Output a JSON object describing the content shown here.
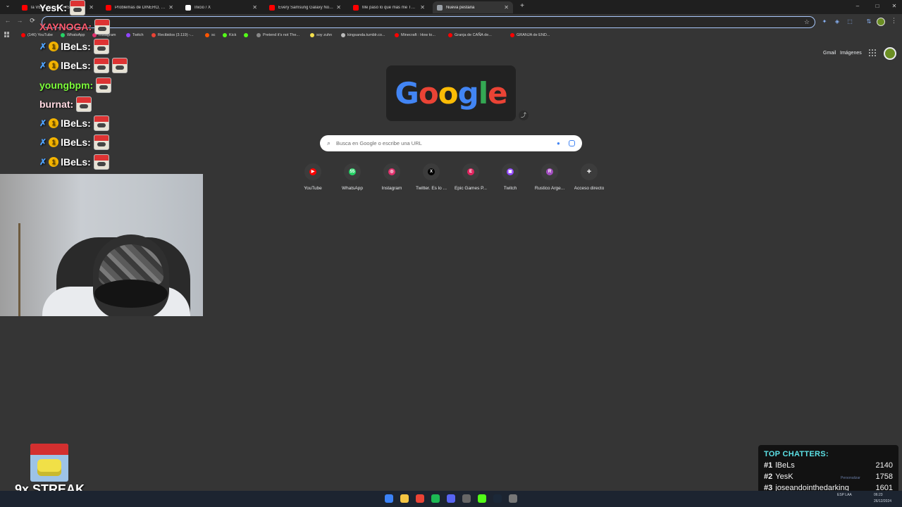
{
  "browser": {
    "tabs": [
      {
        "label": "la VERDADERA HISTO...",
        "favicon_color": "#ff0000",
        "active": false
      },
      {
        "label": "Problemas de DINERO, Nuestr",
        "favicon_color": "#ff0000",
        "active": false
      },
      {
        "label": "Inicio / X",
        "favicon_color": "#ffffff",
        "active": false
      },
      {
        "label": "Every Samsung Galaxy Notificat",
        "favicon_color": "#ff0000",
        "active": false
      },
      {
        "label": "Me pasó lo que más me TEMÍA",
        "favicon_color": "#ff0000",
        "active": false
      },
      {
        "label": "Nueva pestaña",
        "favicon_color": "#9aa0a6",
        "active": true
      }
    ],
    "new_tab_glyph": "+",
    "window_controls": {
      "minimize": "–",
      "maximize": "□",
      "close": "✕"
    },
    "toolbar": {
      "back": "←",
      "forward": "→",
      "reload": "⟳",
      "star": "☆"
    },
    "extensions": [
      "✦",
      "◈",
      "⬚",
      "⇅"
    ],
    "bookmarks": [
      {
        "label": "(146) YouTube",
        "color": "#ff0000"
      },
      {
        "label": "WhatsApp",
        "color": "#25d366"
      },
      {
        "label": "Instagram",
        "color": "#e1306c"
      },
      {
        "label": "Twitch",
        "color": "#9146ff"
      },
      {
        "label": "Recibidos (3.119) -...",
        "color": "#ea4335"
      },
      {
        "label": "sc",
        "color": "#ff5500"
      },
      {
        "label": "Kick",
        "color": "#53fc18"
      },
      {
        "label": "",
        "color": "#53fc18"
      },
      {
        "label": "Pretend it's not The...",
        "color": "#888888"
      },
      {
        "label": "soy zuhn",
        "color": "#f4e04d"
      },
      {
        "label": "kingsanda.tumblr.co...",
        "color": "#bbbbbb"
      },
      {
        "label": "Minecraft : How to...",
        "color": "#ff0000"
      },
      {
        "label": "Granja de CAÑA de...",
        "color": "#ff0000"
      },
      {
        "label": "GRANJA de END...",
        "color": "#ff0000"
      }
    ]
  },
  "ntp": {
    "gmail": "Gmail",
    "images": "Imágenes",
    "doodle_letters": [
      {
        "ch": "G",
        "color": "#4285f4"
      },
      {
        "ch": "o",
        "color": "#ea4335"
      },
      {
        "ch": "o",
        "color": "#fbbc05"
      },
      {
        "ch": "g",
        "color": "#4285f4"
      },
      {
        "ch": "l",
        "color": "#34a853"
      },
      {
        "ch": "e",
        "color": "#ea4335"
      }
    ],
    "share_glyph": "⤴",
    "search_placeholder": "Busca en Google o escribe una URL",
    "search_glyph": "⌕",
    "mic_glyph": "🎙",
    "shortcuts": [
      {
        "label": "YouTube",
        "color": "#ff0000",
        "glyph": "▶"
      },
      {
        "label": "WhatsApp",
        "color": "#25d366",
        "glyph": "55"
      },
      {
        "label": "Instagram",
        "color": "#e1306c",
        "glyph": "◎"
      },
      {
        "label": "Twitter. Es lo ...",
        "color": "#000000",
        "glyph": "X"
      },
      {
        "label": "Epic Games P...",
        "color": "#e0245e",
        "glyph": "E"
      },
      {
        "label": "Twitch",
        "color": "#9146ff",
        "glyph": "▣"
      },
      {
        "label": "Rustico Arge...",
        "color": "#a24dbf",
        "glyph": "R"
      },
      {
        "label": "Acceso directo",
        "color": "#3c3c3c",
        "glyph": "+"
      }
    ]
  },
  "chat": [
    {
      "user": "YesK:",
      "color": "#ffffff",
      "badges": false,
      "emotes": 1
    },
    {
      "user": "XAYNOGA:",
      "color": "#ff5a6e",
      "badges": false,
      "emotes": 1
    },
    {
      "user": "lBeLs:",
      "color": "#ffffff",
      "badges": true,
      "emotes": 1
    },
    {
      "user": "lBeLs:",
      "color": "#ffffff",
      "badges": true,
      "emotes": 2
    },
    {
      "user": "youngbpm:",
      "color": "#7cfc3a",
      "badges": false,
      "emotes": 1
    },
    {
      "user": "burnat:",
      "color": "#ffd8e0",
      "badges": false,
      "emotes": 1
    },
    {
      "user": "lBeLs:",
      "color": "#ffffff",
      "badges": true,
      "emotes": 1
    },
    {
      "user": "lBeLs:",
      "color": "#ffffff",
      "badges": true,
      "emotes": 1
    },
    {
      "user": "lBeLs:",
      "color": "#ffffff",
      "badges": true,
      "emotes": 1
    }
  ],
  "badges": {
    "sword": "✗",
    "coin": "1"
  },
  "streak": {
    "text": "9x STREAK"
  },
  "top_chatters": {
    "title": "TOP CHATTERS:",
    "entries": [
      {
        "rank": "#1",
        "name": "lBeLs",
        "count": "2140"
      },
      {
        "rank": "#2",
        "name": "YesK",
        "count": "1758"
      },
      {
        "rank": "#3",
        "name": "joseandointhedarking",
        "count": "1601"
      }
    ],
    "personalize": "Personalizar"
  },
  "taskbar": {
    "apps": [
      {
        "name": "windows",
        "color": "#3b82f6"
      },
      {
        "name": "explorer",
        "color": "#f4c542"
      },
      {
        "name": "chrome",
        "color": "#ea4335"
      },
      {
        "name": "spotify",
        "color": "#1db954"
      },
      {
        "name": "discord",
        "color": "#5865f2"
      },
      {
        "name": "obs",
        "color": "#666666"
      },
      {
        "name": "kick",
        "color": "#53fc18"
      },
      {
        "name": "steam",
        "color": "#1b2838"
      },
      {
        "name": "other",
        "color": "#777777"
      }
    ],
    "lang": "ESP LAA",
    "time": "06:23",
    "date": "26/12/2024"
  }
}
